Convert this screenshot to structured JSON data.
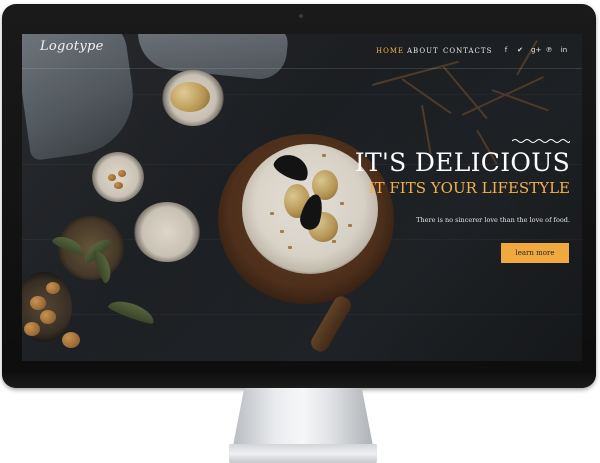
{
  "nav": {
    "logo": "Logotype",
    "items": [
      {
        "label": "HOME",
        "active": true
      },
      {
        "label": "ABOUT",
        "active": false
      },
      {
        "label": "CONTACTS",
        "active": false
      }
    ],
    "social": [
      "facebook-icon",
      "twitter-icon",
      "google-plus-icon",
      "pinterest-icon",
      "linkedin-icon"
    ],
    "social_glyphs": [
      "f",
      "✔",
      "g+",
      "℗",
      "in"
    ]
  },
  "hero": {
    "title": "IT'S DELICIOUS",
    "subtitle": "IT FITS YOUR LIFESTYLE",
    "quote": "There is no sincerer love than the love of food.",
    "button": "learn more"
  },
  "colors": {
    "accent": "#f0b24a",
    "button": "#f0a93e",
    "background": "#1f2226"
  }
}
